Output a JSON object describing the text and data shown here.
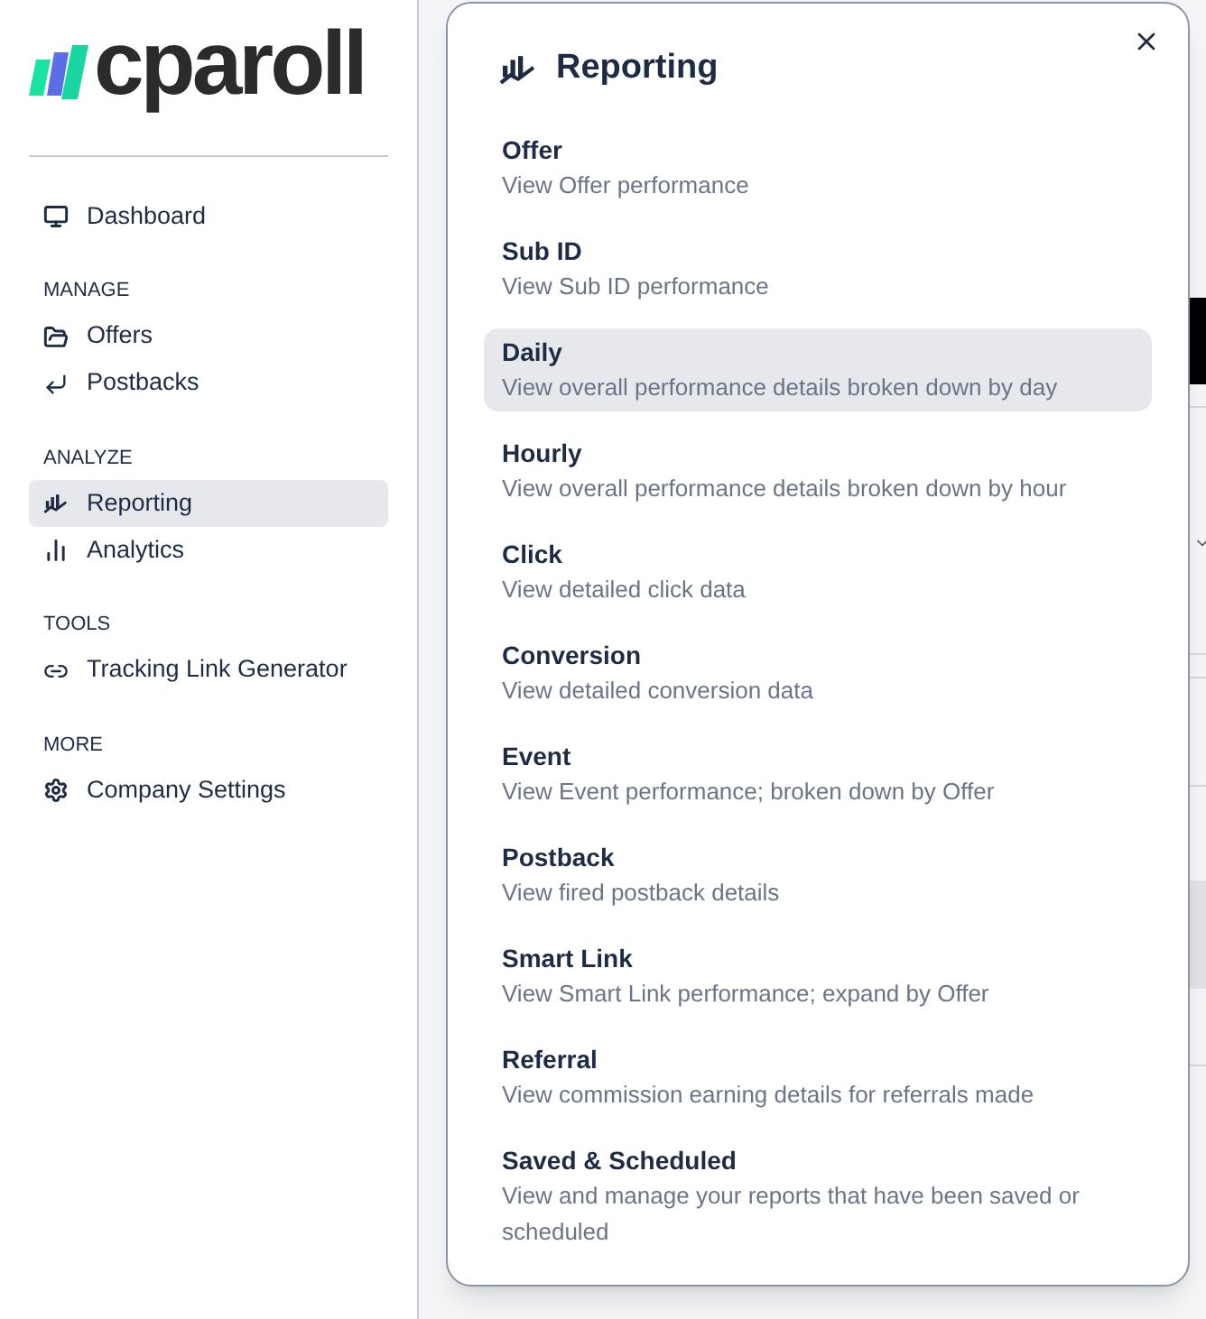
{
  "logo": {
    "text": "cparoll"
  },
  "sidebar": {
    "sections": [
      {
        "items": [
          {
            "label": "Dashboard",
            "selected": false
          }
        ]
      },
      {
        "heading": "MANAGE",
        "items": [
          {
            "label": "Offers",
            "selected": false
          },
          {
            "label": "Postbacks",
            "selected": false
          }
        ]
      },
      {
        "heading": "ANALYZE",
        "items": [
          {
            "label": "Reporting",
            "selected": true
          },
          {
            "label": "Analytics",
            "selected": false
          }
        ]
      },
      {
        "heading": "TOOLS",
        "items": [
          {
            "label": "Tracking Link Generator",
            "selected": false
          }
        ]
      },
      {
        "heading": "MORE",
        "items": [
          {
            "label": "Company Settings",
            "selected": false
          }
        ]
      }
    ]
  },
  "popup": {
    "title": "Reporting",
    "items": [
      {
        "title": "Offer",
        "description": "View Offer performance",
        "selected": false
      },
      {
        "title": "Sub ID",
        "description": "View Sub ID performance",
        "selected": false
      },
      {
        "title": "Daily",
        "description": "View overall performance details broken down by day",
        "selected": true
      },
      {
        "title": "Hourly",
        "description": "View overall performance details broken down by hour",
        "selected": false
      },
      {
        "title": "Click",
        "description": "View detailed click data",
        "selected": false
      },
      {
        "title": "Conversion",
        "description": "View detailed conversion data",
        "selected": false
      },
      {
        "title": "Event",
        "description": "View Event performance; broken down by Offer",
        "selected": false
      },
      {
        "title": "Postback",
        "description": "View fired postback details",
        "selected": false
      },
      {
        "title": "Smart Link",
        "description": "View Smart Link performance; expand by Offer",
        "selected": false
      },
      {
        "title": "Referral",
        "description": "View commission earning details for referrals made",
        "selected": false
      },
      {
        "title": "Saved & Scheduled",
        "description": "View and manage your reports that have been saved or scheduled",
        "selected": false
      }
    ]
  }
}
